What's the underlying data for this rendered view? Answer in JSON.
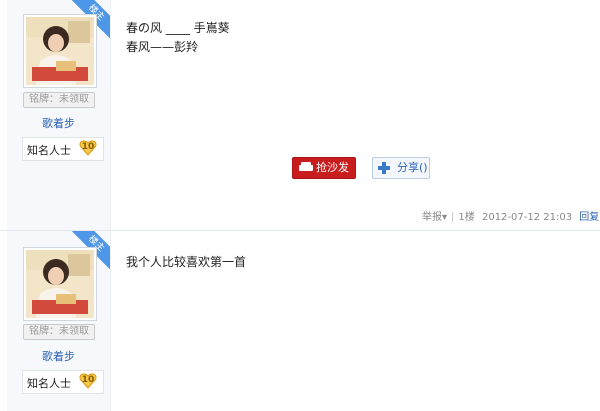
{
  "posts": [
    {
      "corner_label": "楼主",
      "user": {
        "badge": "铭牌：未领取",
        "name": "歌着步",
        "title": "知名人士",
        "level": "10"
      },
      "content_lines": [
        "春の风 ____ 手嶌葵",
        "春风——彭羚"
      ],
      "actions": {
        "sofa_label": "抢沙发",
        "share_label": "分享()"
      },
      "meta": {
        "report": "举报",
        "floor": "1楼",
        "datetime": "2012-07-12 21:03",
        "reply": "回复"
      }
    },
    {
      "corner_label": "楼主",
      "user": {
        "badge": "铭牌：未领取",
        "name": "歌着步",
        "title": "知名人士",
        "level": "10"
      },
      "content_lines": [
        "我个人比较喜欢第一首"
      ]
    }
  ],
  "colors": {
    "accent_blue": "#4e97e8",
    "sofa_red": "#c91d1d",
    "link_blue": "#2d64b3"
  },
  "icons": {
    "sofa": "sofa-icon",
    "share": "plus-icon",
    "level": "heart-badge-icon",
    "report_dropdown": "caret-down-icon"
  }
}
